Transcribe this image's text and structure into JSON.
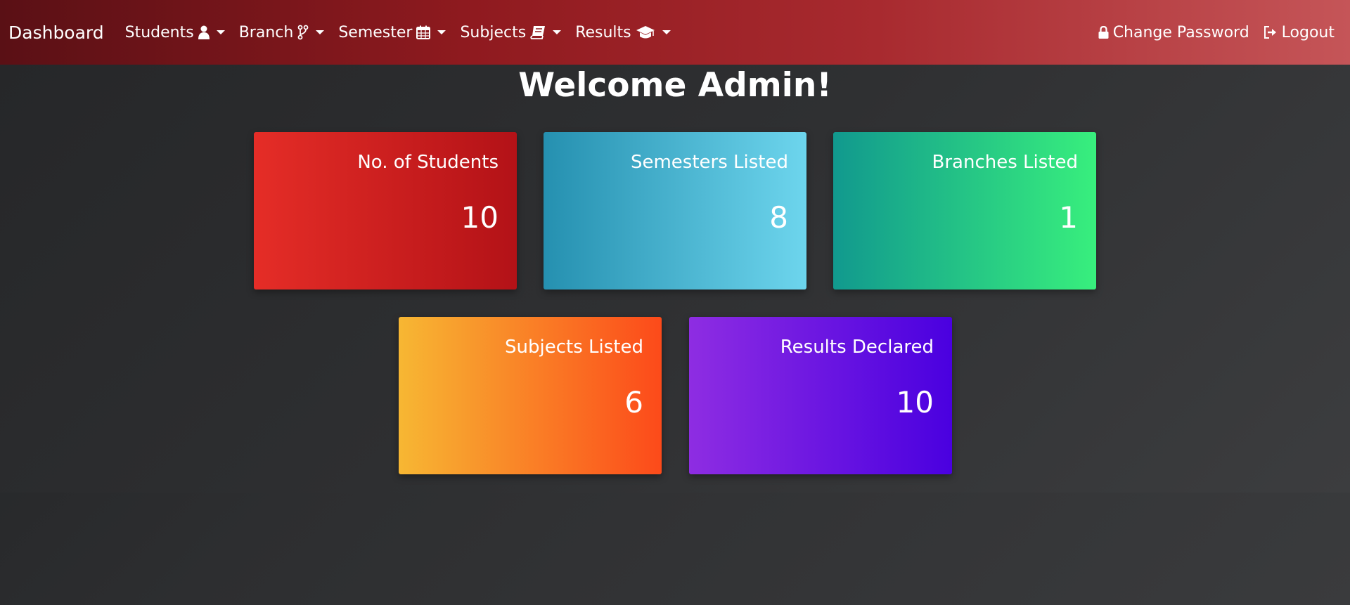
{
  "navbar": {
    "brand": "Dashboard",
    "menus": [
      {
        "label": "Students",
        "icon": "user-icon"
      },
      {
        "label": "Branch",
        "icon": "code-branch-icon"
      },
      {
        "label": "Semester",
        "icon": "calendar-icon"
      },
      {
        "label": "Subjects",
        "icon": "book-icon"
      },
      {
        "label": "Results",
        "icon": "graduation-cap-icon"
      }
    ],
    "right": [
      {
        "label": "Change Password",
        "icon": "lock-icon"
      },
      {
        "label": "Logout",
        "icon": "logout-icon"
      }
    ],
    "colors": {
      "gradient_start": "#5a1015",
      "gradient_end": "#c55558"
    }
  },
  "main": {
    "title": "Welcome Admin!",
    "cards": [
      {
        "label": "No. of Students",
        "value": "10",
        "colors": [
          "#e52d27",
          "#b31217"
        ]
      },
      {
        "label": "Semesters Listed",
        "value": "8",
        "colors": [
          "#2590b0",
          "#6dd5ed"
        ]
      },
      {
        "label": "Branches Listed",
        "value": "1",
        "colors": [
          "#11998e",
          "#38ef7d"
        ]
      },
      {
        "label": "Subjects Listed",
        "value": "6",
        "colors": [
          "#f7b733",
          "#fc4a1a"
        ]
      },
      {
        "label": "Results Declared",
        "value": "10",
        "colors": [
          "#8e2de2",
          "#4a00e0"
        ]
      }
    ]
  }
}
